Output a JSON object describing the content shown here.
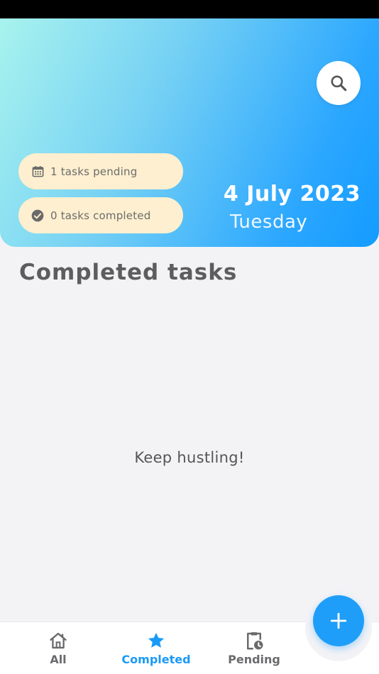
{
  "header": {
    "pending_label": "1 tasks pending",
    "completed_label": "0 tasks completed",
    "date": "4 July 2023",
    "weekday": "Tuesday"
  },
  "main": {
    "section_title": "Completed tasks",
    "empty_message": "Keep hustling!"
  },
  "bottom_nav": {
    "items": [
      {
        "label": "All",
        "icon": "home-icon",
        "active": false
      },
      {
        "label": "Completed",
        "icon": "star-icon",
        "active": true
      },
      {
        "label": "Pending",
        "icon": "clipboard-clock-icon",
        "active": false
      }
    ]
  },
  "colors": {
    "accent": "#1e9ef8",
    "pill_background": "#fdefcf",
    "header_gradient_start": "#a8f3ee",
    "header_gradient_end": "#139cff"
  }
}
